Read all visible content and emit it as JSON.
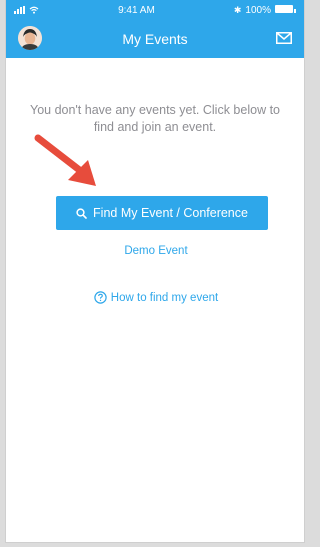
{
  "status_bar": {
    "time": "9:41 AM",
    "battery": "100%",
    "icons": [
      "signal-icon",
      "wifi-icon",
      "bluetooth-icon",
      "battery-icon"
    ]
  },
  "header": {
    "title": "My Events",
    "left_icon": "avatar",
    "right_icon": "mail-icon"
  },
  "main": {
    "empty_message": "You don't have any events yet. Click below to find and join an event.",
    "find_button_label": "Find My Event / Conference",
    "find_button_icon": "search-icon",
    "demo_link": "Demo Event",
    "help_link": "How to find my event",
    "help_icon": "question-circle-icon"
  },
  "colors": {
    "accent": "#2ea7ea",
    "annotation_arrow": "#e74c3c",
    "message_text": "#8e8e93"
  }
}
